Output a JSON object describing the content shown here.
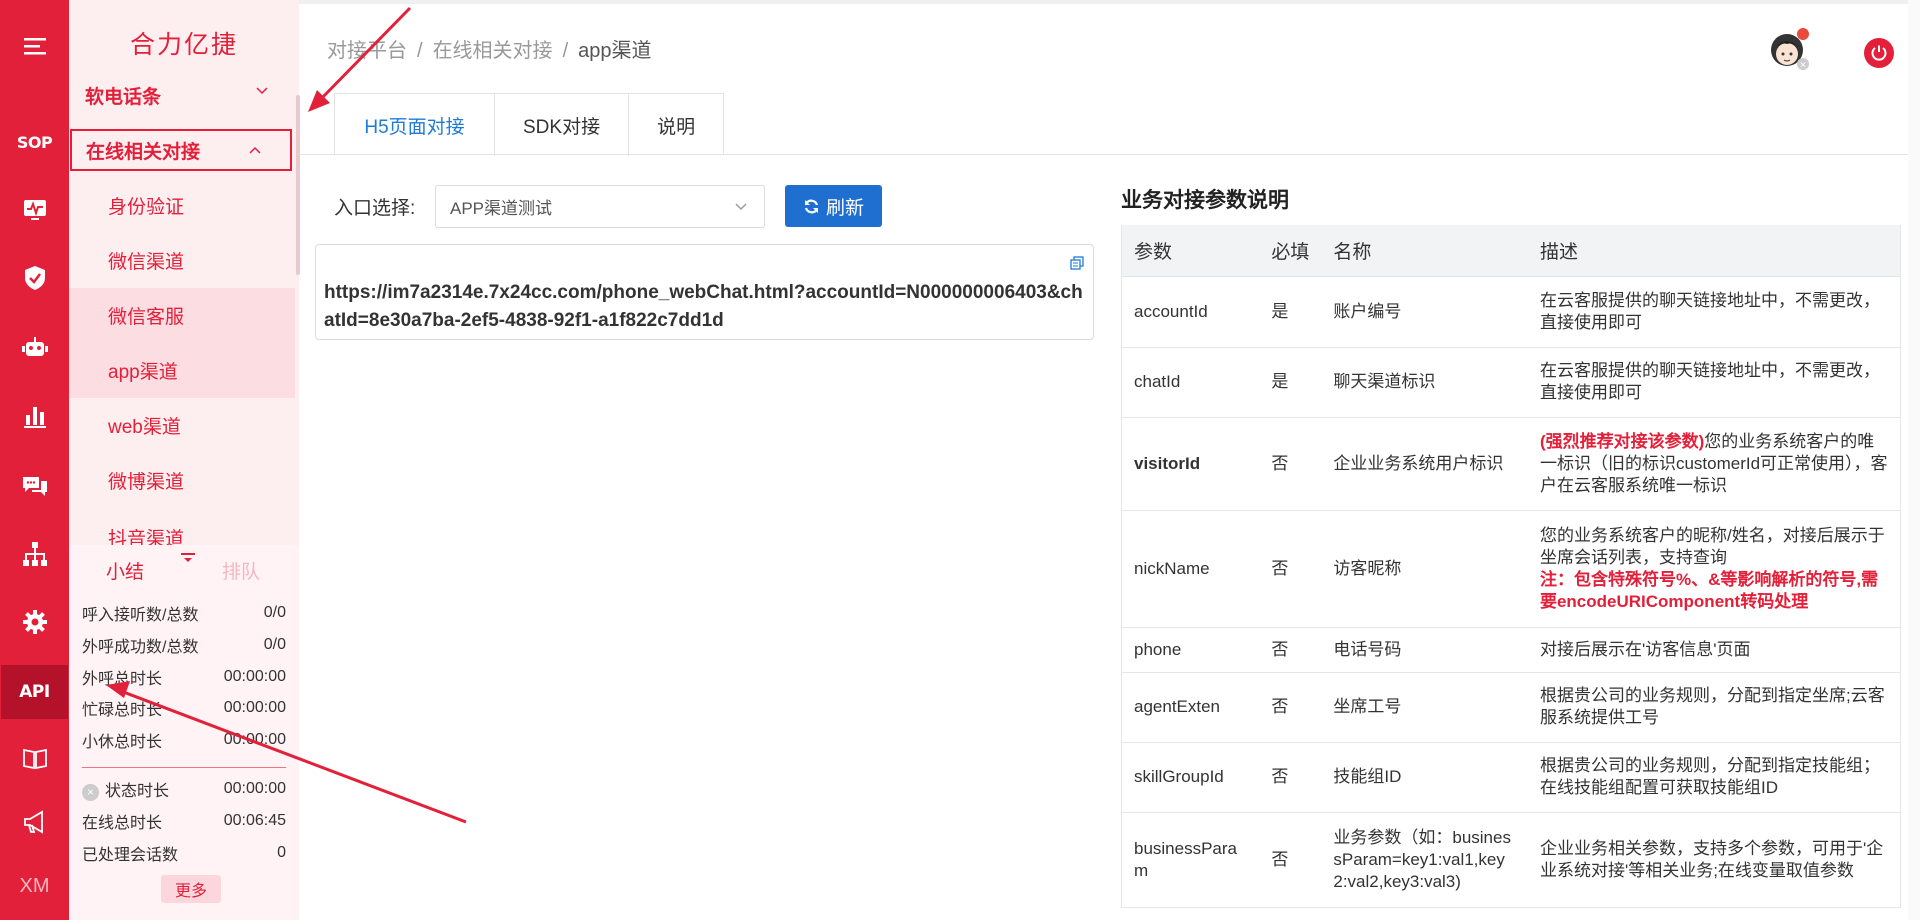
{
  "rail": {
    "items": [
      {
        "name": "menu-toggle-icon",
        "label": ""
      },
      {
        "name": "sop",
        "label": "SOP"
      },
      {
        "name": "monitor-icon",
        "label": ""
      },
      {
        "name": "shield-icon",
        "label": ""
      },
      {
        "name": "robot-icon",
        "label": ""
      },
      {
        "name": "bar-chart-icon",
        "label": ""
      },
      {
        "name": "chat-bubbles-icon",
        "label": ""
      },
      {
        "name": "org-tree-icon",
        "label": ""
      },
      {
        "name": "gear-icon",
        "label": ""
      },
      {
        "name": "api",
        "label": "API"
      },
      {
        "name": "book-icon",
        "label": ""
      },
      {
        "name": "megaphone-icon",
        "label": ""
      },
      {
        "name": "xm",
        "label": "XM"
      }
    ],
    "colors": {
      "background": "#e3203a",
      "active": "#b4122a"
    }
  },
  "sidebar": {
    "brand": "合力亿捷",
    "group_partial": "软电话条",
    "group_open": "在线相关对接",
    "items": [
      {
        "label": "身份验证"
      },
      {
        "label": "微信渠道"
      },
      {
        "label": "微信客服"
      },
      {
        "label": "app渠道"
      },
      {
        "label": "web渠道"
      },
      {
        "label": "微博渠道"
      },
      {
        "label": "抖音渠道"
      }
    ]
  },
  "stats": {
    "tab_active": "小结",
    "tab_inactive": "排队",
    "rows_top": [
      {
        "label": "呼入接听数/总数",
        "value": "0/0"
      },
      {
        "label": "外呼成功数/总数",
        "value": "0/0"
      },
      {
        "label": "外呼总时长",
        "value": "00:00:00"
      },
      {
        "label": "忙碌总时长",
        "value": "00:00:00"
      },
      {
        "label": "小休总时长",
        "value": "00:00:00"
      }
    ],
    "status_label": "状态时长",
    "status_value": "00:00:00",
    "online_label": "在线总时长",
    "online_value": "00:06:45",
    "handled_label": "已处理会话数",
    "handled_value": "0",
    "more": "更多"
  },
  "header": {
    "breadcrumb": [
      "对接平台",
      "在线相关对接",
      "app渠道"
    ],
    "separator": "/"
  },
  "tabs": [
    {
      "label": "H5页面对接",
      "active": true
    },
    {
      "label": "SDK对接",
      "active": false
    },
    {
      "label": "说明",
      "active": false
    }
  ],
  "form": {
    "entry_label": "入口选择:",
    "entry_value": "APP渠道测试",
    "refresh_label": "刷新",
    "url": "https://im7a2314e.7x24cc.com/phone_webChat.html?accountId=N000000006403&chatId=8e30a7ba-2ef5-4838-92f1-a1f822c7dd1d"
  },
  "params": {
    "title": "业务对接参数说明",
    "columns": [
      "参数",
      "必填",
      "名称",
      "描述"
    ],
    "rows": [
      {
        "param": "accountId",
        "required": "是",
        "name": "账户编号",
        "desc": "在云客服提供的聊天链接地址中，不需更改，直接使用即可",
        "desc_red": "",
        "desc_prefix_red": "",
        "highlight": false
      },
      {
        "param": "chatId",
        "required": "是",
        "name": "聊天渠道标识",
        "desc": "在云客服提供的聊天链接地址中，不需更改，直接使用即可",
        "desc_red": "",
        "desc_prefix_red": "",
        "highlight": false
      },
      {
        "param": "visitorId",
        "required": "否",
        "name": "企业业务系统用户标识",
        "desc_prefix_red": "(强烈推荐对接该参数)",
        "desc": "您的业务系统客户的唯一标识（旧的标识customerId可正常使用），客户在云客服系统唯一标识",
        "desc_red": "",
        "highlight": true
      },
      {
        "param": "nickName",
        "required": "否",
        "name": "访客昵称",
        "desc": "您的业务系统客户的昵称/姓名，对接后展示于坐席会话列表，支持查询",
        "desc_red": "注：包含特殊符号%、&等影响解析的符号,需要encodeURIComponent转码处理",
        "desc_prefix_red": "",
        "highlight": false
      },
      {
        "param": "phone",
        "required": "否",
        "name": "电话号码",
        "desc": "对接后展示在'访客信息'页面",
        "desc_red": "",
        "desc_prefix_red": "",
        "highlight": false
      },
      {
        "param": "agentExten",
        "required": "否",
        "name": "坐席工号",
        "desc": "根据贵公司的业务规则，分配到指定坐席;云客服系统提供工号",
        "desc_red": "",
        "desc_prefix_red": "",
        "highlight": false
      },
      {
        "param": "skillGroupId",
        "required": "否",
        "name": "技能组ID",
        "desc": "根据贵公司的业务规则，分配到指定技能组；在线技能组配置可获取技能组ID",
        "desc_red": "",
        "desc_prefix_red": "",
        "highlight": false
      },
      {
        "param": "businessParam",
        "required": "否",
        "name": "业务参数（如：businessParam=key1:val1,key2:val2,key3:val3)",
        "desc": "企业业务相关参数，支持多个参数，可用于'企业系统对接'等相关业务;在线变量取值参数",
        "desc_red": "",
        "desc_prefix_red": "",
        "highlight": false
      }
    ]
  },
  "accent_colors": {
    "brand_red": "#e3203a",
    "link_blue": "#1e7bd8",
    "button_blue": "#1f6fd1"
  }
}
